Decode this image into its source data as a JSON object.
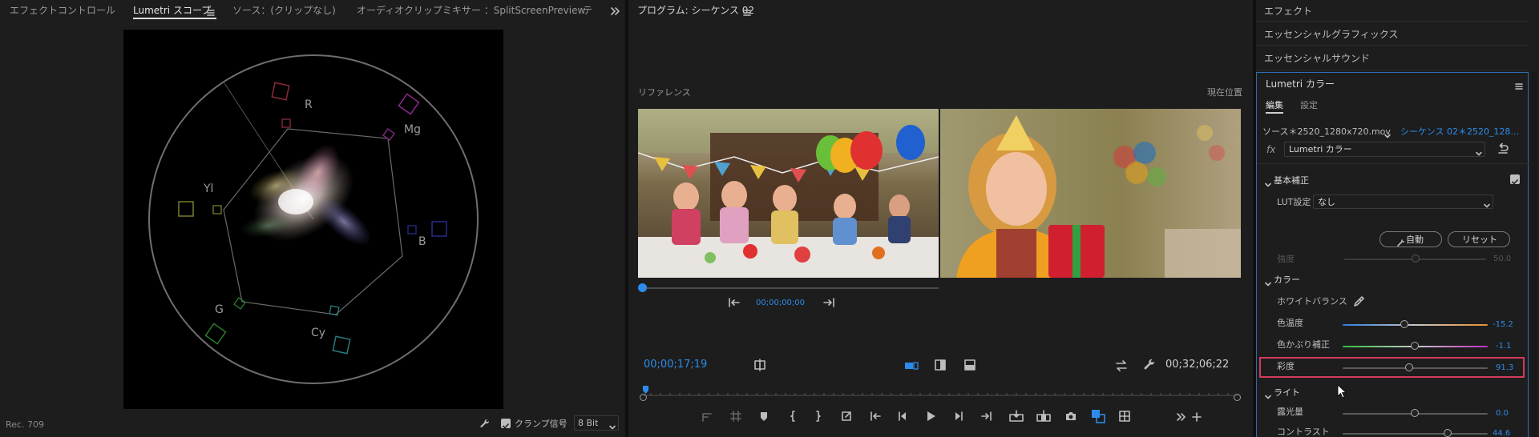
{
  "left_panel": {
    "tabs": [
      "エフェクトコントロール",
      "Lumetri スコープ",
      "ソース：(クリップなし)",
      "オーディオクリップミキサー ：SplitScreenPreview",
      "テ"
    ],
    "active_tab_index": 1,
    "scope_labels": {
      "r": "R",
      "mg": "Mg",
      "b": "B",
      "cy": "Cy",
      "g": "G",
      "yl": "Yl"
    },
    "bottom": {
      "colorspace": "Rec. 709",
      "clamp_label": "クランプ信号",
      "clamp_checked": true,
      "bit_depth": "8 Bit"
    }
  },
  "program_panel": {
    "title": "プログラム: シーケンス 02",
    "reference_label": "リファレンス",
    "current_label": "現在位置",
    "reference_timecode": "00;00;00;00",
    "timecode": "00;00;17;19",
    "duration": "00;32;06;22"
  },
  "right_panel": {
    "collapsed_items": [
      "エフェクト",
      "エッセンシャルグラフィックス",
      "エッセンシャルサウンド"
    ],
    "lumetri_title": "Lumetri カラー",
    "sub_tabs": [
      "編集",
      "設定"
    ],
    "source_label": "ソース＊2520_1280x720.mov",
    "sequence_label": "シーケンス 02＊2520_128…",
    "fx_label": "fx",
    "effect_select": "Lumetri カラー",
    "basic_section": "基本補正",
    "lut_label": "LUT設定",
    "lut_value": "なし",
    "auto_button": "自動",
    "reset_button": "リセット",
    "intensity_label": "強度",
    "intensity_value": "50.0",
    "color_section": "カラー",
    "white_balance_label": "ホワイトバランス",
    "temperature_label": "色温度",
    "temperature_value": "-15.2",
    "tint_label": "色かぶり補正",
    "tint_value": "-1.1",
    "saturation_label": "彩度",
    "saturation_value": "91.3",
    "light_section": "ライト",
    "exposure_label": "露光量",
    "exposure_value": "0.0",
    "contrast_label": "コントラスト",
    "contrast_value": "44.6",
    "accent_color": "#2d8ceb",
    "highlight_color": "#d13b5c"
  }
}
